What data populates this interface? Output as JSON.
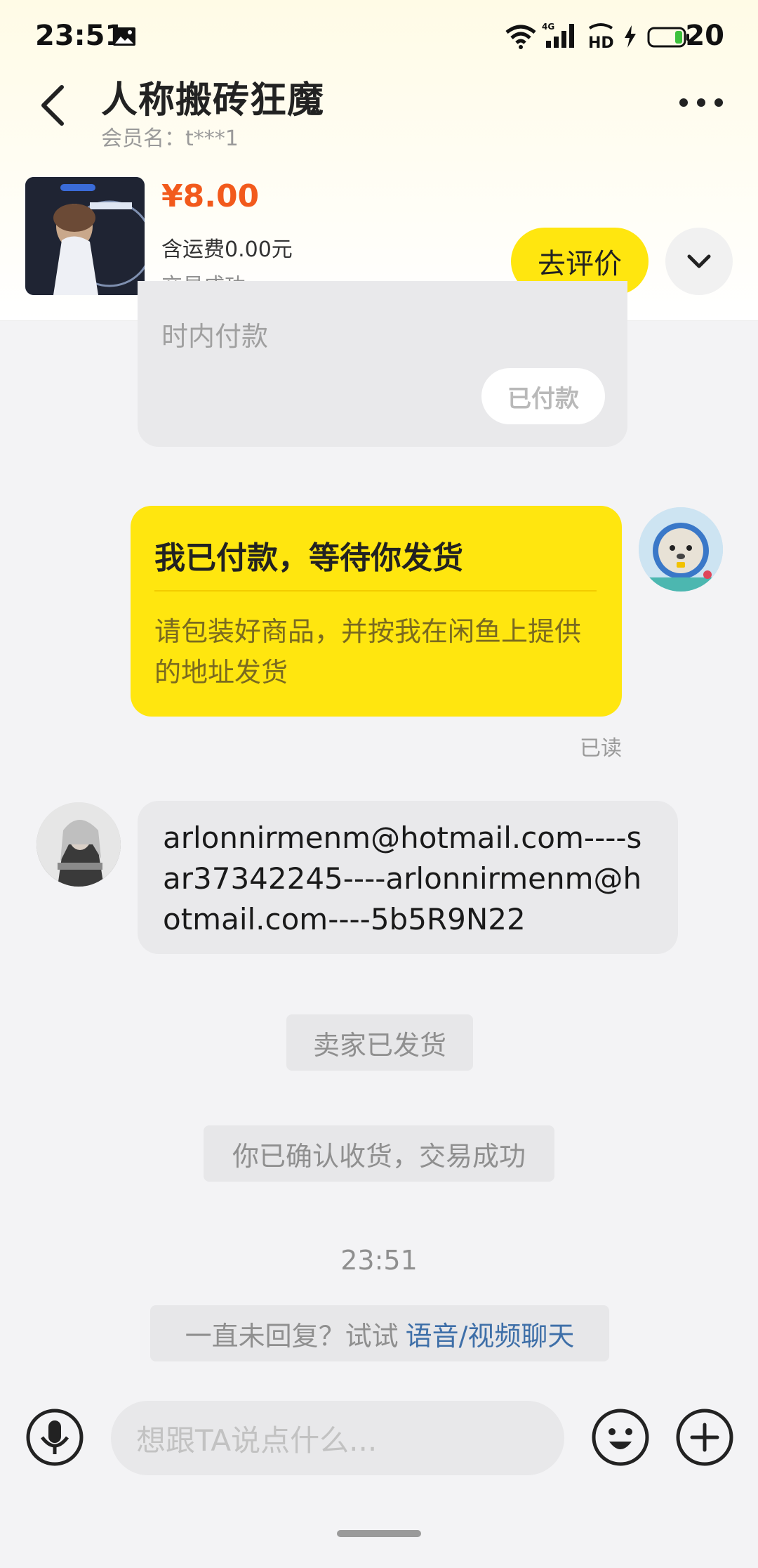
{
  "status_bar": {
    "time": "23:51",
    "battery": "20",
    "icons": [
      "image-icon",
      "wifi-icon",
      "4g-signal-icon",
      "hd-icon",
      "charging-icon",
      "battery-icon"
    ]
  },
  "header": {
    "title": "人称搬砖狂魔",
    "subtitle": "会员名：t***1",
    "back_icon": "chevron-left-icon",
    "more_icon": "more-icon"
  },
  "product": {
    "price": "¥8.00",
    "shipping": "含运费0.00元",
    "status": "交易成功",
    "review_button": "去评价",
    "expand_icon": "chevron-down-icon"
  },
  "chat": {
    "previous_card": {
      "text": "时内付款",
      "button": "已付款"
    },
    "my_message": {
      "title": "我已付款，等待你发货",
      "body": "请包装好商品，并按我在闲鱼上提供的地址发货",
      "read": "已读"
    },
    "seller_message": {
      "text": "arlonnirmenm@hotmail.com----sar37342245----arlonnirmenm@hotmail.com----5b5R9N22"
    },
    "system": {
      "shipped": "卖家已发货",
      "confirmed": "你已确认收货，交易成功",
      "time": "23:51",
      "noreply_prefix": "一直未回复？试试",
      "noreply_link": "语音/视频聊天"
    }
  },
  "input": {
    "placeholder": "想跟TA说点什么...",
    "icons": [
      "microphone-icon",
      "emoji-icon",
      "plus-icon"
    ]
  },
  "colors": {
    "accent_yellow": "#ffe60f",
    "price_orange": "#f25a1c",
    "link_blue": "#3e6fa8"
  }
}
